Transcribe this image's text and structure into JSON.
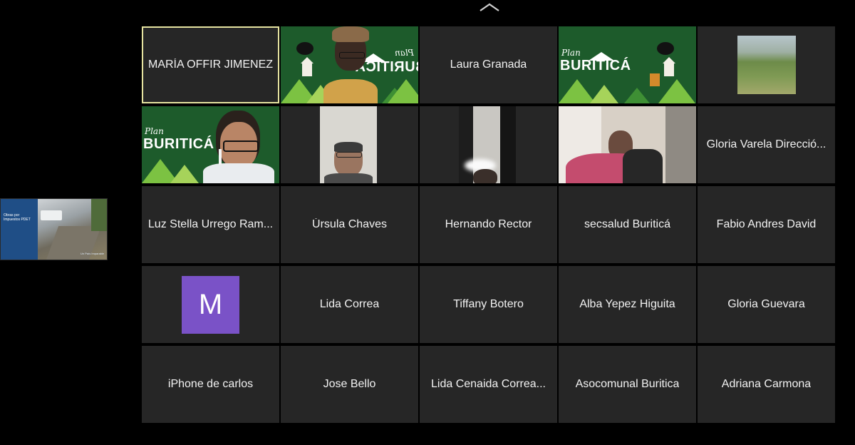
{
  "toolbar": {
    "collapse_icon": "chevron-up-icon"
  },
  "shared_content": {
    "title": "Obras por Impuestos PDET",
    "footer": "Un País Imparable"
  },
  "participants": [
    {
      "name": "MARÍA OFFIR JIMENEZ",
      "type": "name",
      "active": true
    },
    {
      "name": "",
      "type": "video",
      "background": "plan-buritica"
    },
    {
      "name": "Laura Granada",
      "type": "name"
    },
    {
      "name": "",
      "type": "video",
      "background": "plan-buritica"
    },
    {
      "name": "",
      "type": "image",
      "picture": "landscape"
    },
    {
      "name": "",
      "type": "video",
      "background": "plan-buritica"
    },
    {
      "name": "",
      "type": "video"
    },
    {
      "name": "",
      "type": "video"
    },
    {
      "name": "",
      "type": "video"
    },
    {
      "name": "Gloria Varela Direcció...",
      "type": "name"
    },
    {
      "name": "Luz Stella Urrego Ram...",
      "type": "name"
    },
    {
      "name": "Úrsula Chaves",
      "type": "name"
    },
    {
      "name": "Hernando Rector",
      "type": "name"
    },
    {
      "name": "secsalud Buriticá",
      "type": "name"
    },
    {
      "name": "Fabio Andres David",
      "type": "name"
    },
    {
      "name": "",
      "type": "avatar",
      "initial": "M",
      "color": "#7a52c7"
    },
    {
      "name": "Lida Correa",
      "type": "name"
    },
    {
      "name": "Tiffany Botero",
      "type": "name"
    },
    {
      "name": "Alba Yepez Higuita",
      "type": "name"
    },
    {
      "name": "Gloria Guevara",
      "type": "name"
    },
    {
      "name": "iPhone de carlos",
      "type": "name"
    },
    {
      "name": "Jose Bello",
      "type": "name"
    },
    {
      "name": "Lida Cenaida Correa...",
      "type": "name"
    },
    {
      "name": "Asocomunal Buritica",
      "type": "name"
    },
    {
      "name": "Adriana Carmona",
      "type": "name"
    }
  ],
  "brand": {
    "plan": "Plan",
    "wordmark": "BURITICÁ"
  },
  "colors": {
    "background": "#000000",
    "tile": "#262626",
    "active_border": "#e6e3a0",
    "brand_green": "#1d5b2b"
  }
}
